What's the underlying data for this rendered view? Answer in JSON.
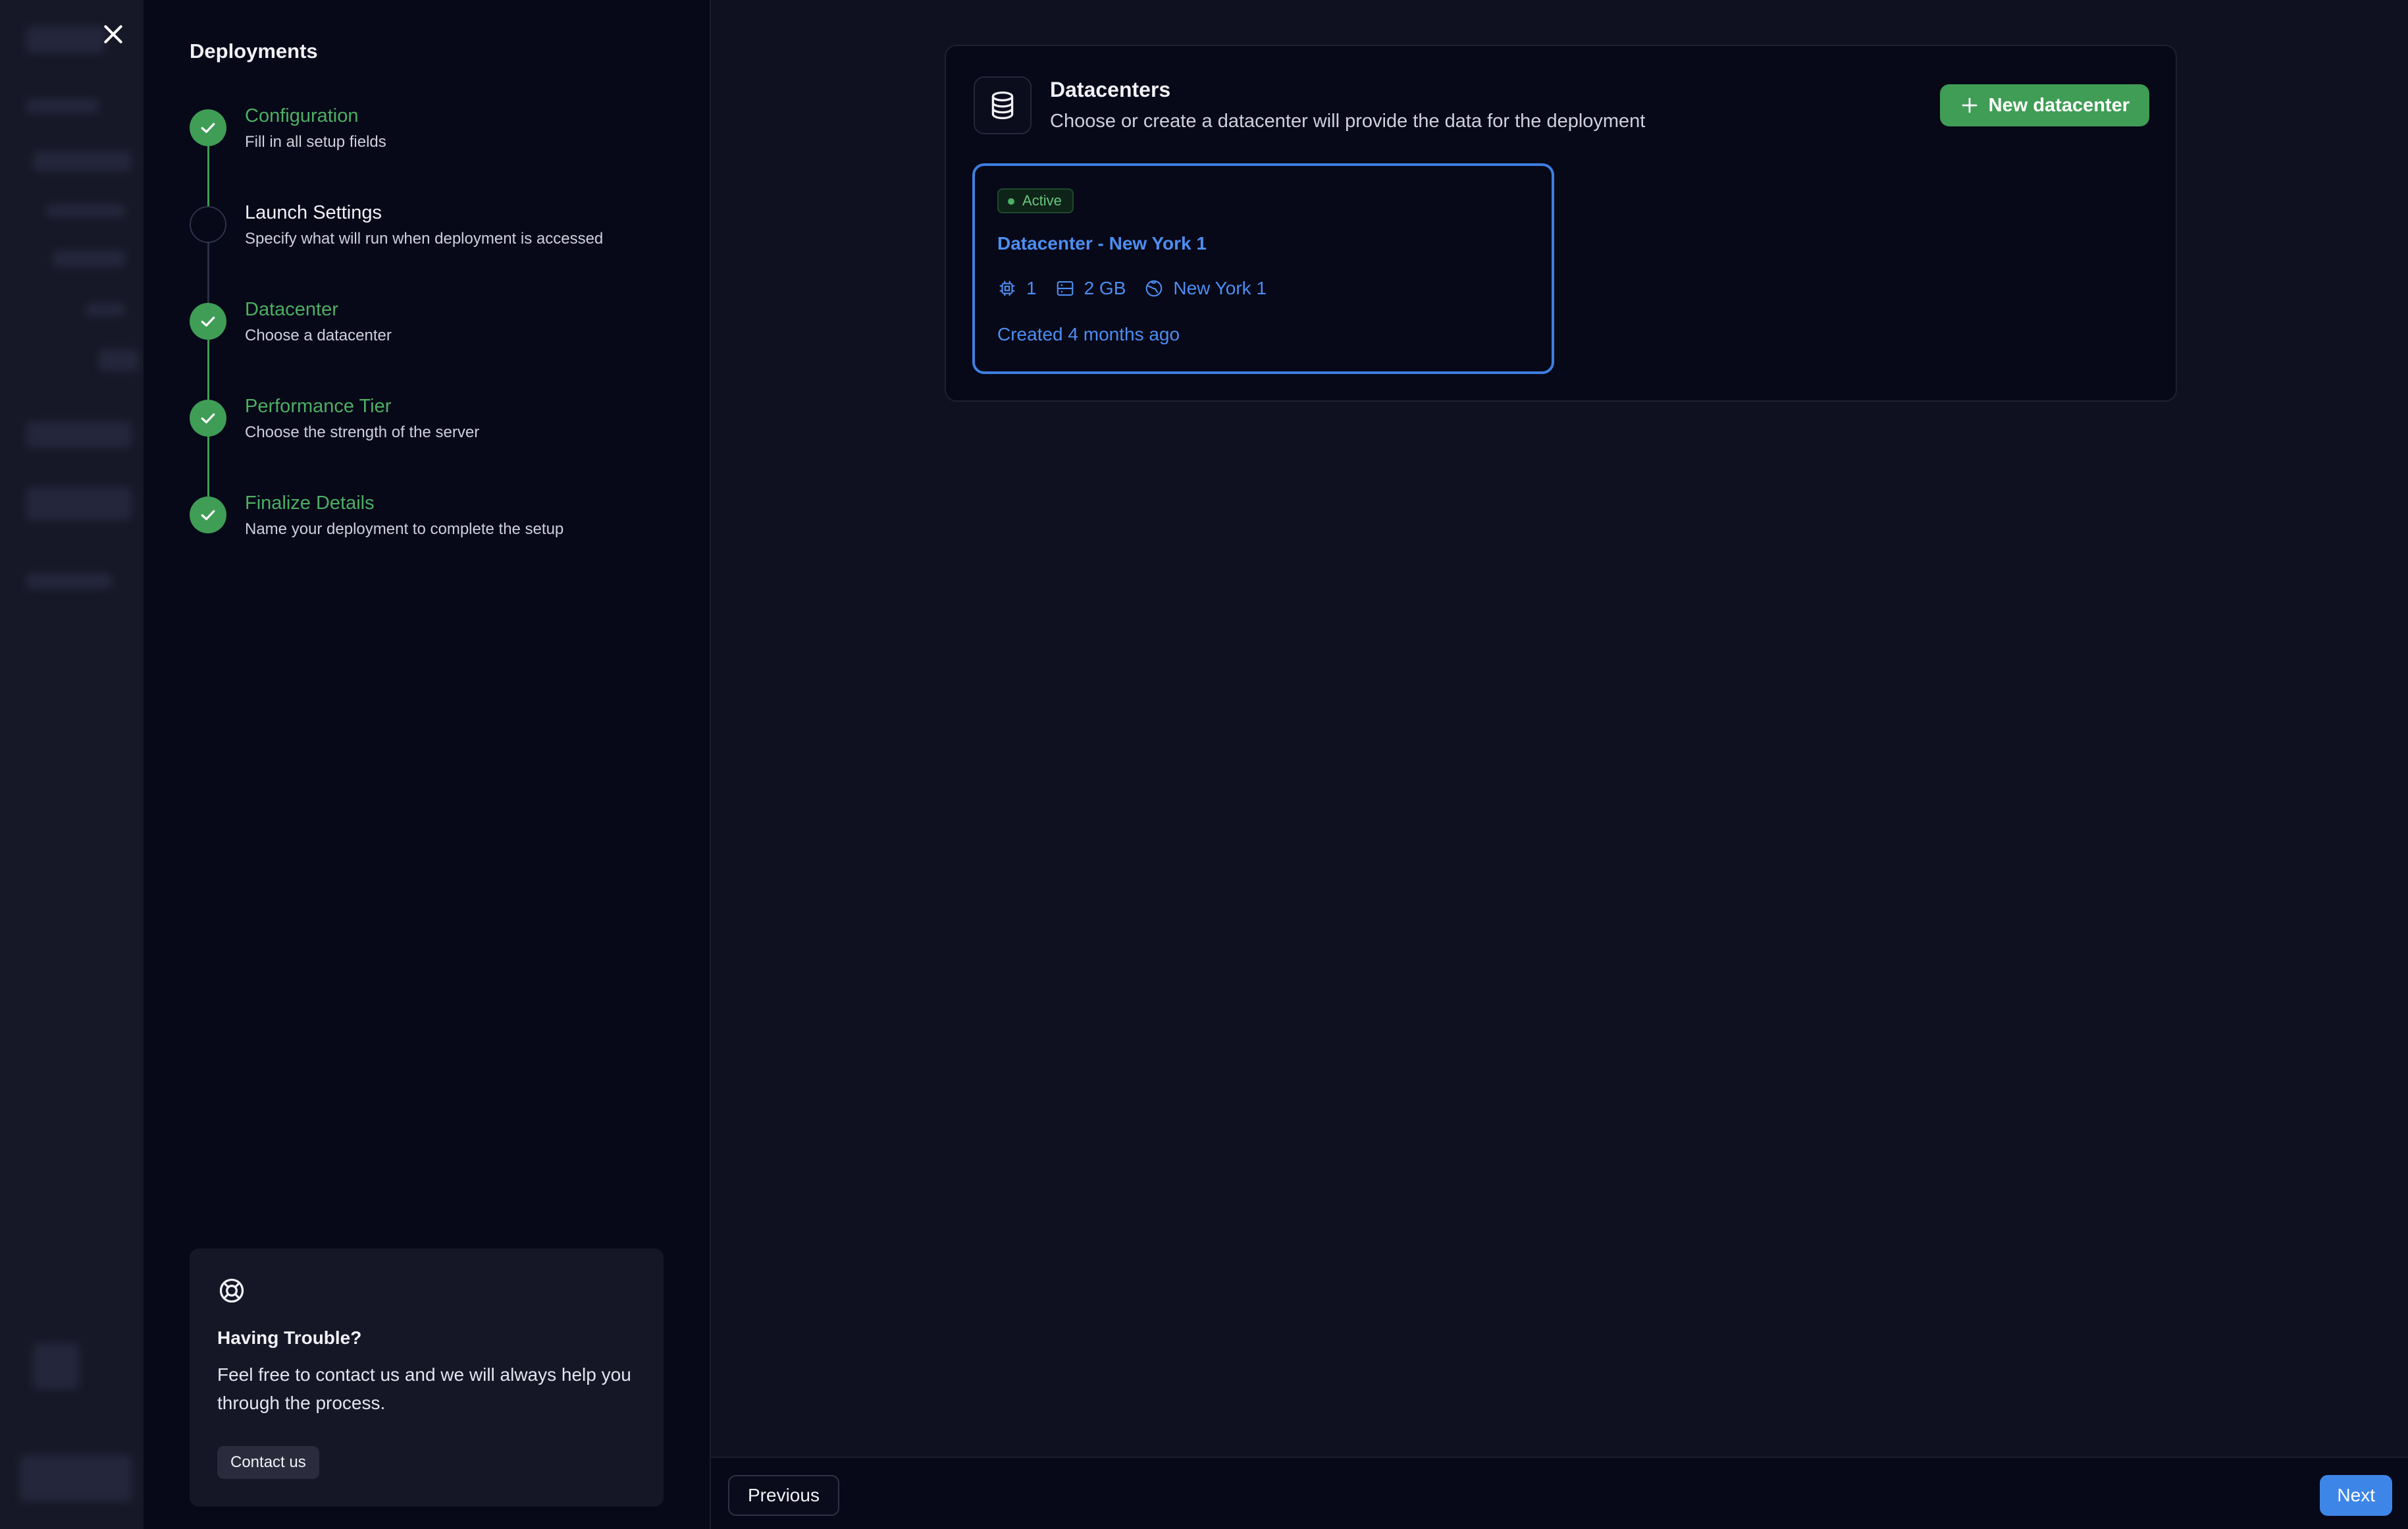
{
  "wizard": {
    "title": "Deployments",
    "steps": [
      {
        "title": "Configuration",
        "subtitle": "Fill in all setup fields",
        "status": "done"
      },
      {
        "title": "Launch Settings",
        "subtitle": "Specify what will run when deployment is accessed",
        "status": "pending"
      },
      {
        "title": "Datacenter",
        "subtitle": "Choose a datacenter",
        "status": "done"
      },
      {
        "title": "Performance Tier",
        "subtitle": "Choose the strength of the server",
        "status": "done"
      },
      {
        "title": "Finalize Details",
        "subtitle": "Name your deployment to complete the setup",
        "status": "done"
      }
    ],
    "help": {
      "title": "Having Trouble?",
      "text": "Feel free to contact us and we will always help you through the process.",
      "button": "Contact us"
    }
  },
  "datacenters": {
    "title": "Datacenters",
    "subtitle": "Choose or create a datacenter will provide the data for the deployment",
    "new_button": "New datacenter",
    "cards": [
      {
        "status": "Active",
        "name": "Datacenter - New York 1",
        "cpu": "1",
        "memory": "2 GB",
        "region": "New York 1",
        "created": "Created 4 months ago"
      }
    ]
  },
  "footer": {
    "previous": "Previous",
    "next": "Next"
  },
  "colors": {
    "success": "#3f9d55",
    "accent": "#3d86e8",
    "background": "#101120",
    "panel": "#070818"
  }
}
